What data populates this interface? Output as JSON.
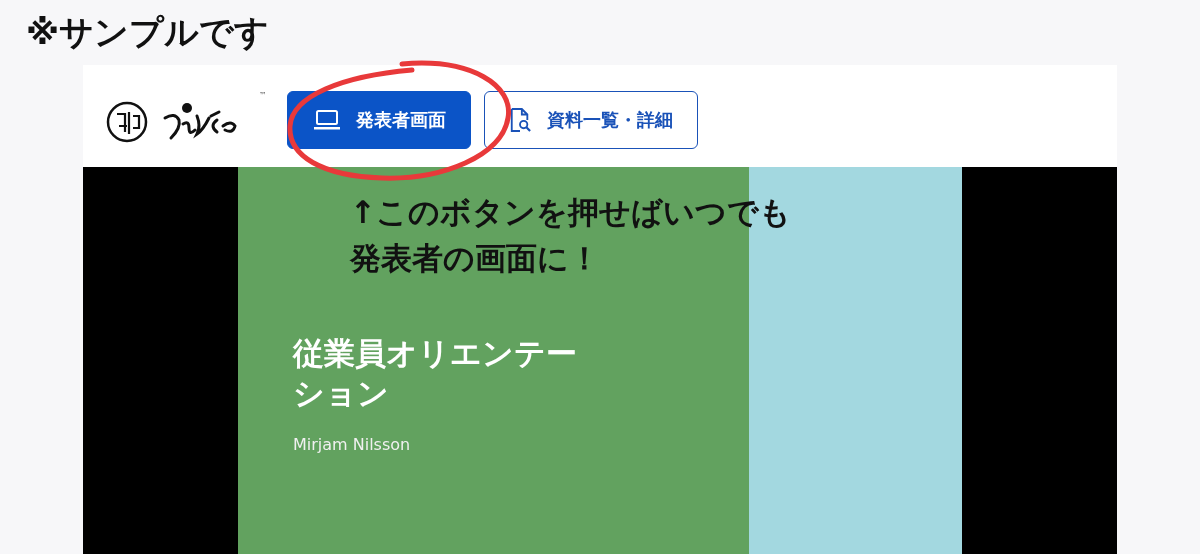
{
  "note": "※サンプルです",
  "header": {
    "trademark": "™",
    "buttons": [
      {
        "label": "発表者画面",
        "kind": "presenter",
        "selected": true
      },
      {
        "label": "資料一覧・詳細",
        "kind": "documents",
        "selected": false
      }
    ]
  },
  "annotation": {
    "lines": [
      "↑このボタンを押せばいつでも",
      "発表者の画面に！"
    ]
  },
  "slide": {
    "title": "従業員オリエンテーション",
    "author": "Mirjam Nilsson"
  }
}
